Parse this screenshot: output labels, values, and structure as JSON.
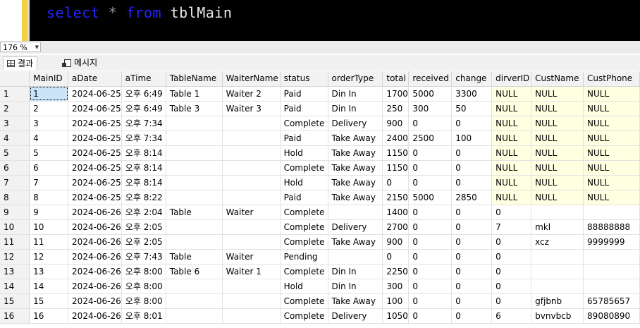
{
  "editor": {
    "query": [
      {
        "text": "select",
        "kind": "kw"
      },
      {
        "text": " * ",
        "kind": "op"
      },
      {
        "text": "from",
        "kind": "kw"
      },
      {
        "text": " tblMain",
        "kind": "id"
      }
    ]
  },
  "zoom": {
    "level": "176 %"
  },
  "tabs": [
    {
      "label": "결과",
      "icon": "grid-icon",
      "active": true
    },
    {
      "label": "메시지",
      "icon": "message-icon",
      "active": false
    }
  ],
  "grid": {
    "columns": [
      "MainID",
      "aDate",
      "aTime",
      "TableName",
      "WaiterName",
      "status",
      "orderType",
      "total",
      "received",
      "change",
      "dirverID",
      "CustName",
      "CustPhone"
    ],
    "rows": [
      [
        "1",
        "2024-06-25",
        "오후 6:49",
        "Table 1",
        "Waiter 2",
        "Paid",
        "Din In",
        "1700",
        "5000",
        "3300",
        "NULL",
        "NULL",
        "NULL"
      ],
      [
        "2",
        "2024-06-25",
        "오후 6:49",
        "Table 3",
        "Waiter 3",
        "Paid",
        "Din In",
        "250",
        "300",
        "50",
        "NULL",
        "NULL",
        "NULL"
      ],
      [
        "3",
        "2024-06-25",
        "오후 7:34",
        "",
        "",
        "Complete",
        "Delivery",
        "900",
        "0",
        "0",
        "NULL",
        "NULL",
        "NULL"
      ],
      [
        "4",
        "2024-06-25",
        "오후 7:34",
        "",
        "",
        "Paid",
        "Take Away",
        "2400",
        "2500",
        "100",
        "NULL",
        "NULL",
        "NULL"
      ],
      [
        "5",
        "2024-06-25",
        "오후 8:14",
        "",
        "",
        "Hold",
        "Take Away",
        "1150",
        "0",
        "0",
        "NULL",
        "NULL",
        "NULL"
      ],
      [
        "6",
        "2024-06-25",
        "오후 8:14",
        "",
        "",
        "Complete",
        "Take Away",
        "1150",
        "0",
        "0",
        "NULL",
        "NULL",
        "NULL"
      ],
      [
        "7",
        "2024-06-25",
        "오후 8:14",
        "",
        "",
        "Hold",
        "Take Away",
        "0",
        "0",
        "0",
        "NULL",
        "NULL",
        "NULL"
      ],
      [
        "8",
        "2024-06-25",
        "오후 8:22",
        "",
        "",
        "Paid",
        "Take Away",
        "2150",
        "5000",
        "2850",
        "NULL",
        "NULL",
        "NULL"
      ],
      [
        "9",
        "2024-06-26",
        "오후 2:04",
        "Table",
        "Waiter",
        "Complete",
        "",
        "1400",
        "0",
        "0",
        "0",
        "",
        ""
      ],
      [
        "10",
        "2024-06-26",
        "오후 2:05",
        "",
        "",
        "Complete",
        "Delivery",
        "2700",
        "0",
        "0",
        "7",
        "mkl",
        "88888888"
      ],
      [
        "11",
        "2024-06-26",
        "오후 2:05",
        "",
        "",
        "Complete",
        "Take Away",
        "900",
        "0",
        "0",
        "0",
        "xcz",
        "9999999"
      ],
      [
        "12",
        "2024-06-26",
        "오후 7:43",
        "Table",
        "Waiter",
        "Pending",
        "",
        "0",
        "0",
        "0",
        "0",
        "",
        ""
      ],
      [
        "13",
        "2024-06-26",
        "오후 8:00",
        "Table 6",
        "Waiter 1",
        "Complete",
        "Din In",
        "2250",
        "0",
        "0",
        "0",
        "",
        ""
      ],
      [
        "14",
        "2024-06-26",
        "오후 8:00",
        "",
        "",
        "Hold",
        "Din In",
        "300",
        "0",
        "0",
        "0",
        "",
        ""
      ],
      [
        "15",
        "2024-06-26",
        "오후 8:00",
        "",
        "",
        "Complete",
        "Take Away",
        "100",
        "0",
        "0",
        "0",
        "gfjbnb",
        "65785657"
      ],
      [
        "16",
        "2024-06-26",
        "오후 8:01",
        "",
        "",
        "Complete",
        "Delivery",
        "1050",
        "0",
        "0",
        "6",
        "bvnvbcb",
        "89080890"
      ]
    ]
  }
}
